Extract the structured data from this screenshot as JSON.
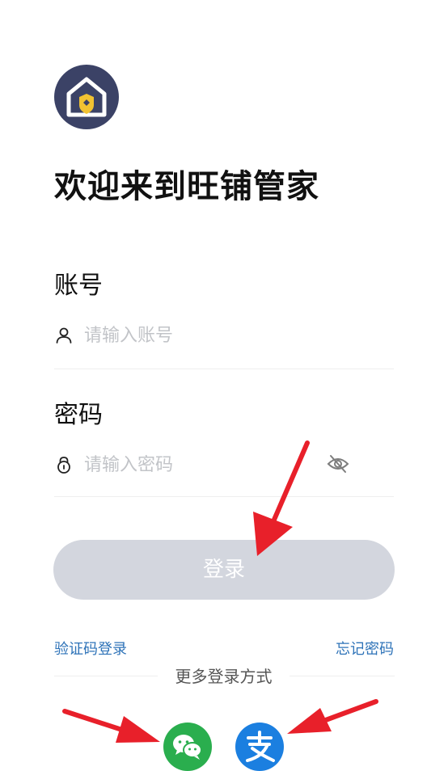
{
  "app": {
    "welcome_title": "欢迎来到旺铺管家",
    "logo_icon": "house-shield-icon"
  },
  "form": {
    "account_label": "账号",
    "account_placeholder": "请输入账号",
    "account_icon": "user-icon",
    "password_label": "密码",
    "password_placeholder": "请输入密码",
    "password_icon": "lock-icon",
    "visibility_icon": "eye-off-icon"
  },
  "actions": {
    "login_label": "登录",
    "sms_login_label": "验证码登录",
    "forgot_password_label": "忘记密码"
  },
  "more_login": {
    "title": "更多登录方式",
    "options": [
      {
        "icon": "wechat-icon",
        "color": "#2aae4e"
      },
      {
        "icon": "alipay-icon",
        "color": "#1b7fe0"
      }
    ]
  },
  "colors": {
    "logo_bg": "#3b4266",
    "logo_accent": "#f1c232",
    "button_disabled": "#d3d6de",
    "link": "#2e73b8",
    "annotation_arrow": "#e8202a"
  }
}
